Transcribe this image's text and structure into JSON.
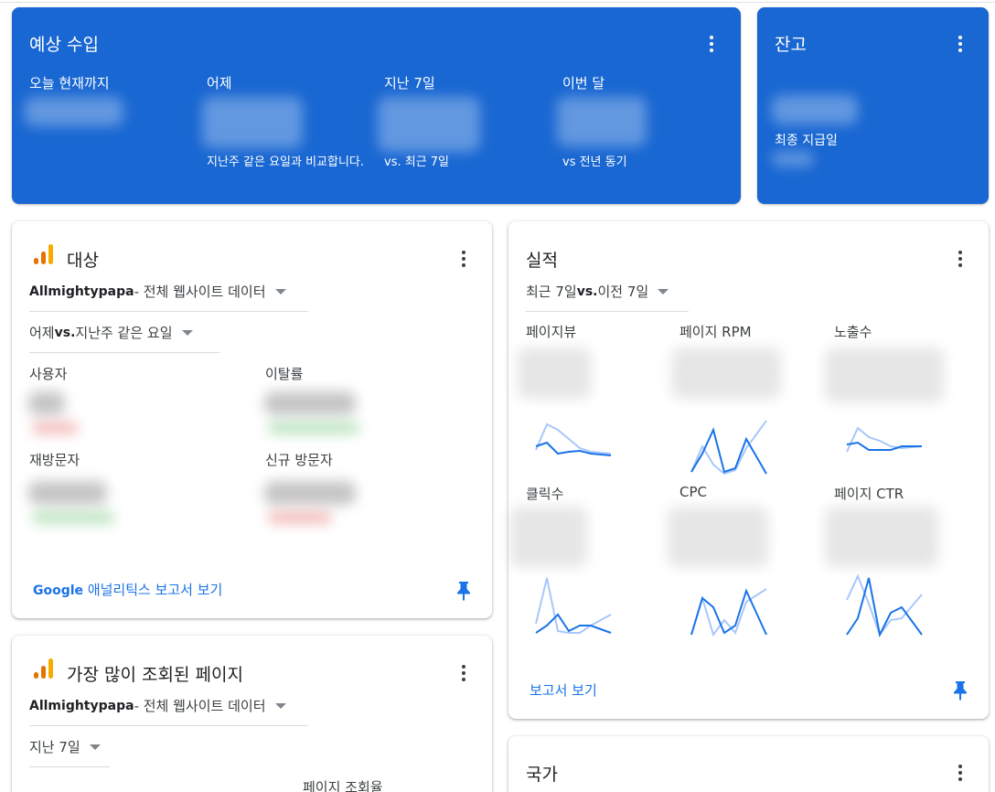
{
  "estimated_earnings": {
    "title": "예상 수입",
    "columns": [
      {
        "label": "오늘 현재까지",
        "note": ""
      },
      {
        "label": "어제",
        "note": "지난주 같은 요일과 비교합니다."
      },
      {
        "label": "지난 7일",
        "note": "vs. 최근 7일"
      },
      {
        "label": "이번 달",
        "note": "vs 전년 동기"
      }
    ]
  },
  "balance": {
    "title": "잔고",
    "last_payment_label": "최종 지급일"
  },
  "audience": {
    "title": "대상",
    "property_strong": "Allmightypapa",
    "property_rest": " - 전체 웹사이트 데이터",
    "compare_strong": "vs.",
    "compare_before": "어제 ",
    "compare_after": " 지난주 같은 요일",
    "metrics": [
      "사용자",
      "이탈률",
      "재방문자",
      "신규 방문자"
    ],
    "link_strong": "Google",
    "link_rest": " 애널리틱스 보고서 보기"
  },
  "performance": {
    "title": "실적",
    "range_before": "최근 7일 ",
    "range_strong": "vs.",
    "range_after": " 이전 7일",
    "metrics": [
      "페이지뷰",
      "페이지 RPM",
      "노출수",
      "클릭수",
      "CPC",
      "페이지 CTR"
    ],
    "link": "보고서 보기"
  },
  "top_pages": {
    "title": "가장 많이 조회된 페이지",
    "property_strong": "Allmightypapa",
    "property_rest": " - 전체 웹사이트 데이터",
    "range": "지난 7일",
    "column_header": "페이지 조회율"
  },
  "country": {
    "title": "국가"
  },
  "colors": {
    "brand_blue": "#1967d2",
    "link_blue": "#1a73e8",
    "spark_dark": "#1a73e8",
    "spark_light": "#a8c7fa"
  },
  "icons": {
    "menu": "more-vert-icon",
    "analytics": "google-analytics-icon",
    "pin": "pin-icon"
  }
}
